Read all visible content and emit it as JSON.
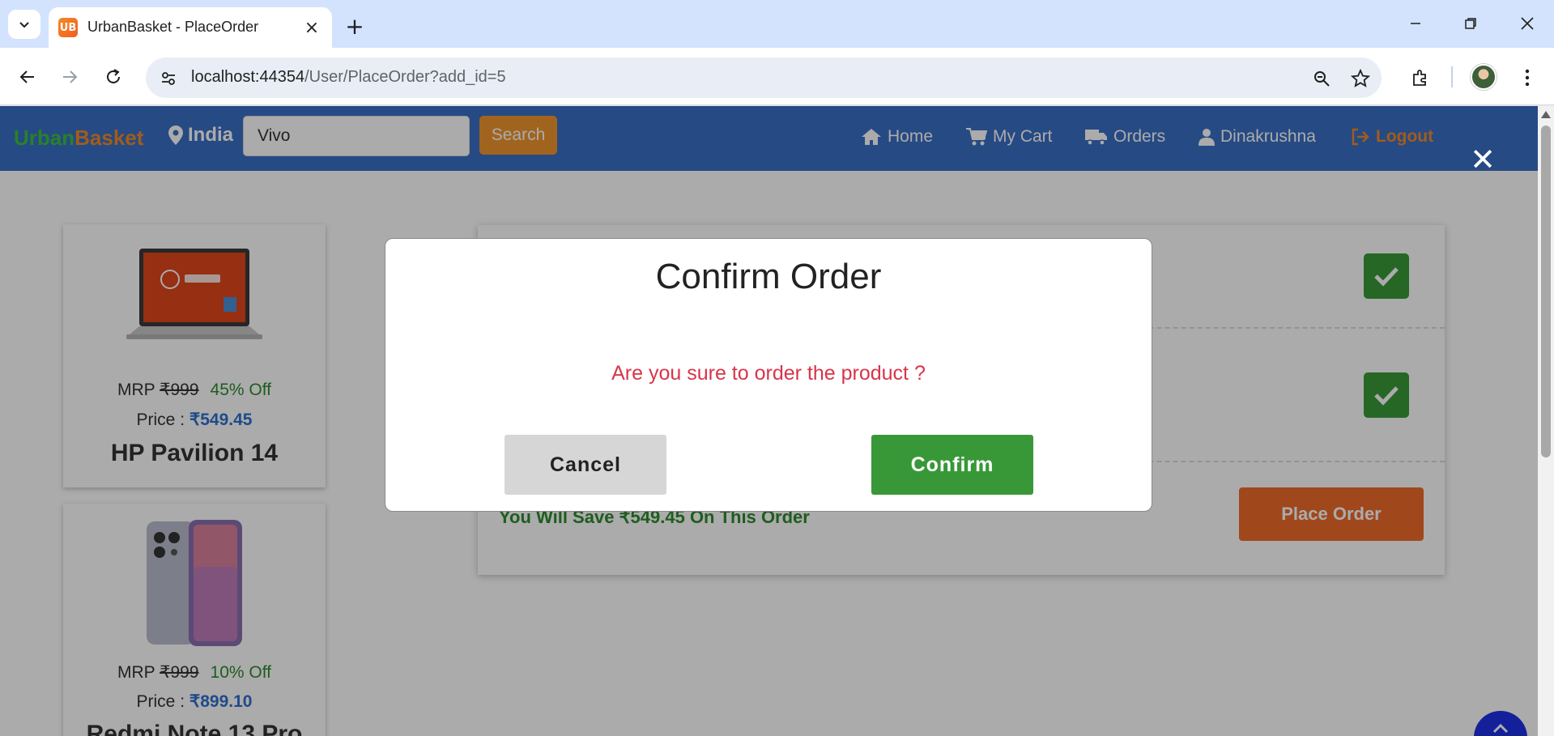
{
  "browser": {
    "tab_title": "UrbanBasket - PlaceOrder",
    "favicon_text": "UB",
    "url_host": "localhost:44354",
    "url_path": "/User/PlaceOrder?add_id=5"
  },
  "navbar": {
    "brand_part1": "Urban",
    "brand_part2": "Basket",
    "location": "India",
    "search_value": "Vivo",
    "search_button": "Search",
    "links": {
      "home": "Home",
      "cart": "My Cart",
      "orders": "Orders",
      "user": "Dinakrushna",
      "logout": "Logout"
    }
  },
  "products": [
    {
      "mrp_label": "MRP ",
      "mrp_value": "₹999",
      "discount": "45% Off",
      "price_label": "Price : ",
      "price_value": "₹549.45",
      "name": "HP Pavilion 14",
      "image_icon": "laptop-image"
    },
    {
      "mrp_label": "MRP ",
      "mrp_value": "₹999",
      "discount": "10% Off",
      "price_label": "Price : ",
      "price_value": "₹899.10",
      "name": "Redmi Note 13 Pro",
      "image_icon": "phone-image"
    }
  ],
  "order_panel": {
    "savings_text": "You Will Save ₹549.45 On This Order",
    "place_order_button": "Place Order"
  },
  "modal": {
    "title": "Confirm Order",
    "message": "Are you sure to order the product ?",
    "cancel_button": "Cancel",
    "confirm_button": "Confirm"
  },
  "colors": {
    "navbar": "#3a6fc4",
    "brand_green": "#3fbf3f",
    "brand_orange": "#f08a2a",
    "confirm_green": "#389838",
    "message_red": "#d9344a",
    "place_order": "#f06a2a"
  }
}
